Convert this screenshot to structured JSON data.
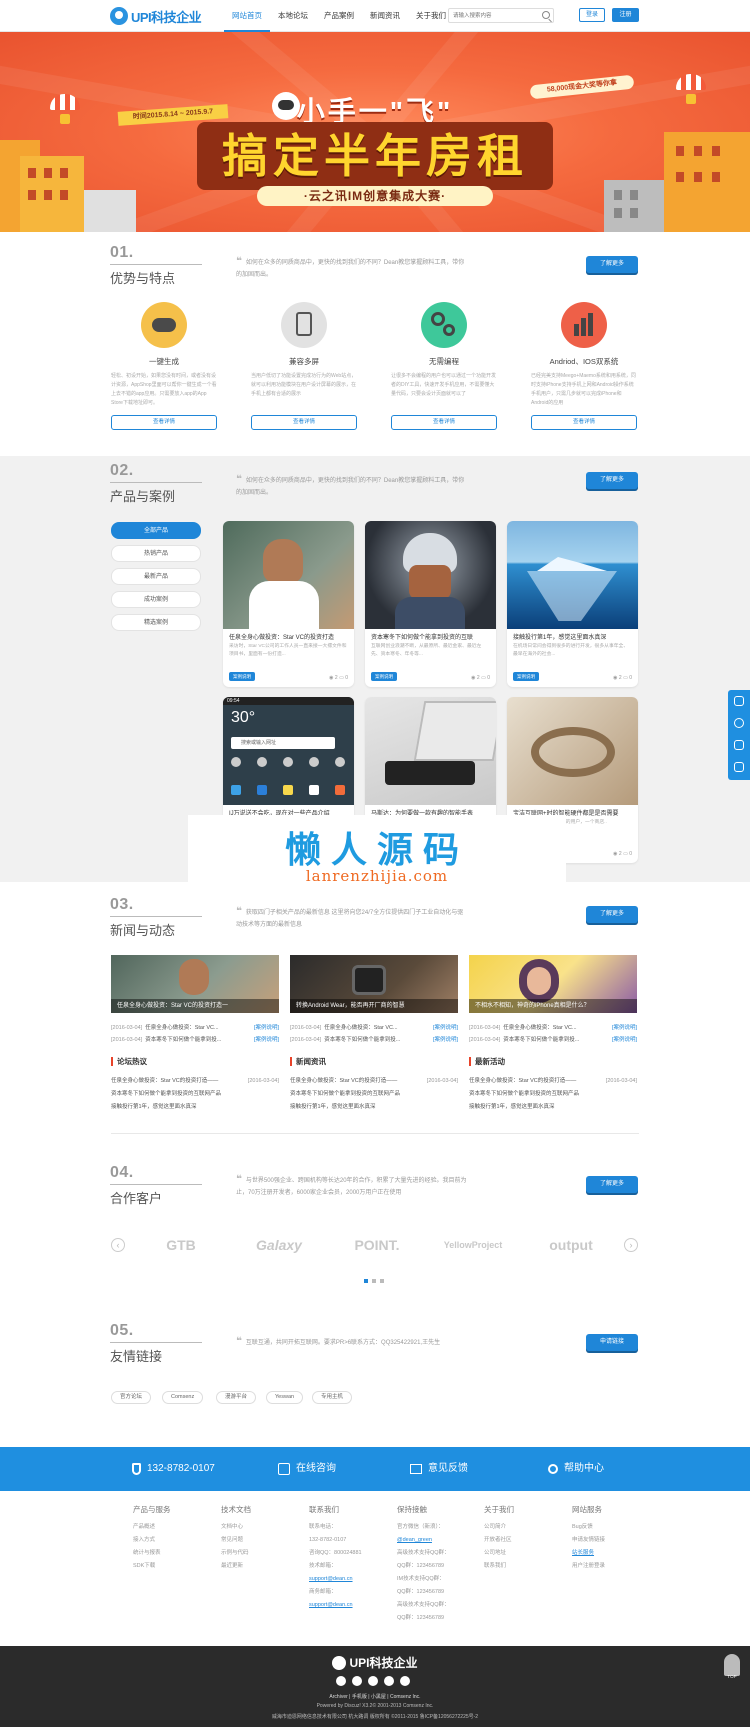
{
  "header": {
    "logo_text": "UPI科技企业",
    "nav": [
      "网站首页",
      "本地论坛",
      "产品案例",
      "新闻资讯",
      "关于我们"
    ],
    "search_placeholder": "请输入搜索内容",
    "login": "登录",
    "register": "注册"
  },
  "banner": {
    "date": "时间2015.8.14 ~ 2015.9.7",
    "prize": "58,000现金大奖等你拿",
    "line1": "小手一\"飞\"",
    "line2": "搞定半年房租",
    "line3": "·云之讯IM创意集成大赛·"
  },
  "sections": {
    "s1": {
      "num": "01.",
      "title": "优势与特点",
      "desc": "如何在众多的同质商品中，更快的找到我们的不同？Dean教您掌握顾料工具，带你的加固而出。",
      "btn": "了解更多"
    },
    "s2": {
      "num": "02.",
      "title": "产品与案例",
      "desc": "如何在众多的同质商品中，更快的找到我们的不同？Dean教您掌握顾料工具，带你的加固而出。",
      "btn": "了解更多"
    },
    "s3": {
      "num": "03.",
      "title": "新闻与动态",
      "desc": "获取四门子相关产品的最新信息 这里将向您24/7全方位提供四门子工业自动化与驱动技术等方面的最新信息",
      "btn": "了解更多"
    },
    "s4": {
      "num": "04.",
      "title": "合作客户",
      "desc": "与世界500强企业、跨国机构等长达20年的合作，积累了大量先进的经验。我目前为止，70万注册开发者，6000家企业会员，2000万用户正在使用",
      "btn": "了解更多"
    },
    "s5": {
      "num": "05.",
      "title": "友情链接",
      "desc": "互联互通，共同开拓互联网。要求PR>6联系方式：QQ325422921,王先生",
      "btn": "申请链接"
    }
  },
  "features": [
    {
      "title": "一键生成",
      "desc": "轻松、初设开始，如果您没有时间，或者没有设计资源，AppShop里面可以帮你一键生成一个看上去不错的app应用。只需要放入app的App Store下载地址即可。",
      "btn": "查看详情",
      "color": "#f5c04a",
      "icon": "cloud-icon"
    },
    {
      "title": "兼容多屏",
      "desc": "当用户低切了功能设置完成功行为的Web站点，就可以利用功能模块在用户设计屏幕的展示，在手机上都有合适的展示",
      "btn": "查看详情",
      "color": "#d9d9d9",
      "icon": "tablet-icon"
    },
    {
      "title": "无需编程",
      "desc": "让很多不会编程的用户也可以通过一个功能开发者的DIY工具，快速开发手机应用，不需要懂大量代码，只要会设计页面就可以了",
      "btn": "查看详情",
      "color": "#3ec89a",
      "icon": "gears-icon"
    },
    {
      "title": "Andriod、IOS双系统",
      "desc": "已经完美支持Meego+Maemo系统和用系统，同时支持iPhone支持手机上网和Android操作系统手机用户，只需几步就可以完成iPhone和Android的应用",
      "btn": "查看详情",
      "color": "#ee6048",
      "icon": "bar-chart-icon"
    }
  ],
  "products": {
    "sidebar": [
      "全部产品",
      "热销产品",
      "最新产品",
      "成功案例",
      "精选案例"
    ],
    "cards": [
      {
        "title": "任泉全身心做投资：Star VC的投资打造",
        "desc": "采访时，Star VC公司的工作人员一直来接一大摞文件和项目书，里面有一份打造...",
        "tag": "案例说明",
        "views": "2",
        "comments": "0"
      },
      {
        "title": "资本寒冬下如何做个能拿到投资的互联",
        "desc": "互联网创业浪潮不断，从最原所、最近金家、最近左先、资本寒冬、年冬等...",
        "tag": "案例说明",
        "views": "2",
        "comments": "0"
      },
      {
        "title": "接触投行第1年，感觉这里面水真深",
        "desc": "在机场日常间会得到很多的进行开发，很多从事年全、最早在海外的社会...",
        "tag": "案例说明",
        "views": "2",
        "comments": "0"
      },
      {
        "title": "IJ万说送不会吃，现在对一些产品介绍",
        "desc": "",
        "tag": "案例说明",
        "views": "2",
        "comments": "0"
      },
      {
        "title": "马斯达：为何要做一款有趣的智能手表",
        "desc": "",
        "tag": "案例说明",
        "views": "2",
        "comments": "0"
      },
      {
        "title": "宝洁互联网+时的智能硬件都是是否需要",
        "desc": "如果大家的产品都在最终的用户，一个商店..",
        "tag": "案例说明",
        "views": "2",
        "comments": "0"
      }
    ],
    "phone_weather": "30°",
    "phone_search": "搜索或输入网址"
  },
  "watermark": {
    "line1": "懒人源码",
    "line2": "lanrenzhijia.com"
  },
  "news": {
    "featured": [
      "任泉全身心做投资：Star VC的投资打造一",
      "转换Android Wear，能否再开厂商的智慧",
      "不相水不相知，神奇的iPhone真相是什么？"
    ],
    "rows": [
      {
        "date": "[2016-03-04]",
        "title": "任泉全身心做投资：Star VC...",
        "cat": "[案例说明]"
      },
      {
        "date": "[2016-03-04]",
        "title": "资本寒冬下如何做个能拿到投...",
        "cat": "[案例说明]"
      }
    ],
    "columns": [
      {
        "title": "论坛热议",
        "items": [
          "任泉全身心做投资：Star VC的投资打造——",
          "资本寒冬下如何做个能拿到投资的互联网产品",
          "接触投行第1年，感觉这里面水真深"
        ]
      },
      {
        "title": "新闻资讯",
        "items": [
          "任泉全身心做投资：Star VC的投资打造——",
          "资本寒冬下如何做个能拿到投资的互联网产品",
          "接触投行第1年，感觉这里面水真深"
        ]
      },
      {
        "title": "最新活动",
        "items": [
          "任泉全身心做投资：Star VC的投资打造——",
          "资本寒冬下如何做个能拿到投资的互联网产品",
          "接触投行第1年，感觉这里面水真深"
        ]
      }
    ],
    "list_date": "[2016-03-04]"
  },
  "partners": [
    "GTB",
    "Galaxy",
    "POINT.",
    "YellowProject",
    "output"
  ],
  "links": [
    "官方论坛",
    "Comsenz",
    "漫游平台",
    "Yeswan",
    "专用主机"
  ],
  "contact": {
    "phone": "132-8782-0107",
    "online": "在线咨询",
    "feedback": "意见反馈",
    "help": "帮助中心"
  },
  "footer_cols": [
    {
      "title": "产品与服务",
      "items": [
        "产品概述",
        "接入方式",
        "统计与报表",
        "SDK下载"
      ]
    },
    {
      "title": "技术文档",
      "items": [
        "文档中心",
        "常见问题",
        "示例与代码",
        "最近更新"
      ]
    },
    {
      "title": "联系我们",
      "items": [
        "联系电话：",
        "132-8782-0107",
        "咨询QQ：800024881",
        "技术邮箱：",
        "support@dean.cn",
        "商务邮箱：",
        "support@dean.cn"
      ]
    },
    {
      "title": "保持接触",
      "items": [
        "官方微信（新浪）：",
        "@dean_green",
        "高级技术支持QQ群：",
        "QQ群：123456789",
        "IM技术支持QQ群：",
        "QQ群：123456789",
        "高级技术支持QQ群：",
        "QQ群：123456789"
      ]
    },
    {
      "title": "关于我们",
      "items": [
        "公司简介",
        "开放者社区",
        "公司地址",
        "联系我们"
      ]
    },
    {
      "title": "网站服务",
      "items": [
        "Bug反馈",
        "申请友情链接",
        "站长服务",
        "用户注册登录"
      ]
    }
  ],
  "dark_footer": {
    "logo_text": "UPI科技企业",
    "links": "Archiver | 手机版 | 小黑屋 | Comsenz Inc.",
    "powered": "Powered by Discuz! X3.2© 2001-2013 Comsenz Inc.",
    "copyright": "威海市迪恩网络信息技术有限公司 杭大路调 版权所有 ©2011-2015 鲁ICP备12056272225号-2",
    "top": "TOP"
  },
  "colors": {
    "accent": "#1f86d8",
    "contact_bar": "#1f8fe0",
    "banner": "#f56a3f"
  }
}
